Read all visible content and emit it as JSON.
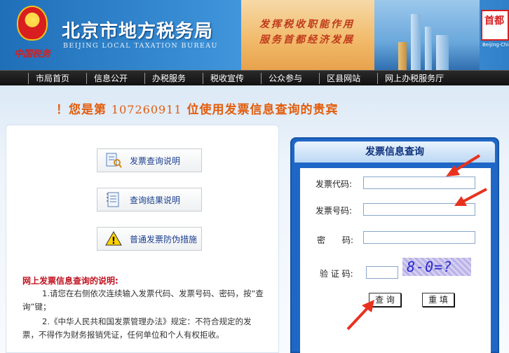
{
  "header": {
    "bureau_cn": "北京市地方税务局",
    "bureau_en": "BEIJING LOCAL TAXATION BUREAU",
    "tagline": "中国税务",
    "slogan_line1": "发挥税收职能作用",
    "slogan_line2": "服务首都经济发展",
    "right_logo_text": "首都",
    "right_logo_en": "Beijing·Chi"
  },
  "nav": {
    "items": [
      "市局首页",
      "信息公开",
      "办税服务",
      "税收宣传",
      "公众参与",
      "区县网站",
      "网上办税服务厅"
    ]
  },
  "welcome": {
    "prefix": "！您是第",
    "count": "107260911",
    "suffix": "位使用发票信息查询的贵宾"
  },
  "links": {
    "invoice_query_help": "发票查询说明",
    "result_help": "查询结果说明",
    "anti_fake": "普通发票防伪措施"
  },
  "notes": {
    "title": "网上发票信息查询的说明:",
    "item1": "1.请您在右侧依次连续输入发票代码、发票号码、密码，按“查询”键；",
    "item2": "2.《中华人民共和国发票管理办法》规定：不符合规定的发票，不得作为财务报销凭证，任何单位和个人有权拒收。"
  },
  "query": {
    "title": "发票信息查询",
    "code_label": "发票代码:",
    "number_label": "发票号码:",
    "password_label": "密　　码:",
    "captcha_label": "验 证 码:",
    "captcha_text": "8-0=?",
    "submit": "查 询",
    "reset": "重 填"
  },
  "colors": {
    "accent_orange": "#e35c0a",
    "panel_blue": "#1f67c6",
    "notes_red": "#c1121f",
    "arrow_red": "#e8321f"
  }
}
